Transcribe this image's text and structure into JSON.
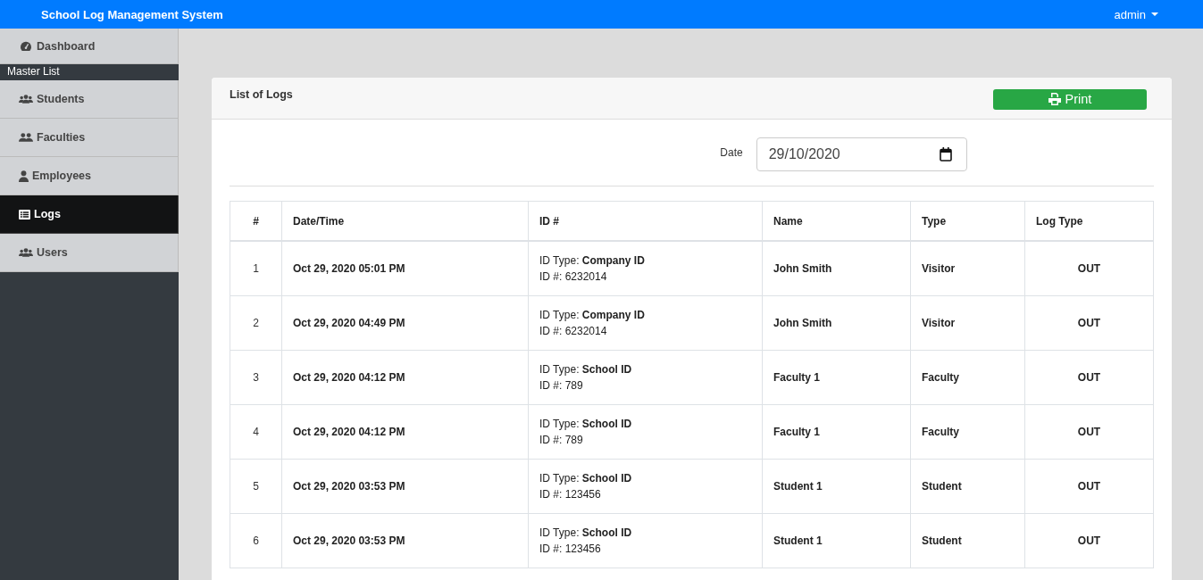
{
  "navbar": {
    "title": "School Log Management System",
    "user": "admin"
  },
  "sidebar": {
    "top_items": [
      {
        "label": "Dashboard",
        "kind": "gauge",
        "selected": false
      }
    ],
    "section_title": "Master List",
    "items": [
      {
        "label": "Students",
        "kind": "users",
        "selected": false
      },
      {
        "label": "Faculties",
        "kind": "pair",
        "selected": false
      },
      {
        "label": "Employees",
        "kind": "user",
        "selected": false
      },
      {
        "label": "Logs",
        "kind": "list",
        "selected": true
      },
      {
        "label": "Users",
        "kind": "users",
        "selected": false
      }
    ]
  },
  "card": {
    "title": "List of Logs",
    "print_button": "Print",
    "date_label": "Date",
    "date_value": "29/10/2020",
    "table": {
      "columns": [
        "#",
        "Date/Time",
        "ID #",
        "Name",
        "Type",
        "Log Type"
      ],
      "rows": [
        {
          "number": "1",
          "datetime": "Oct 29, 2020 05:01 PM",
          "id_type": "ID Type: **Company ID**",
          "id_number": "ID #: 6232014",
          "name": "John Smith",
          "type": "Visitor",
          "log_type": "OUT"
        },
        {
          "number": "2",
          "datetime": "Oct 29, 2020 04:49 PM",
          "id_type": "ID Type: **Company ID**",
          "id_number": "ID #: 6232014",
          "name": "John Smith",
          "type": "Visitor",
          "log_type": "OUT"
        },
        {
          "number": "3",
          "datetime": "Oct 29, 2020 04:12 PM",
          "id_type": "ID Type: **School ID**",
          "id_number": "ID #: 789",
          "name": "Faculty 1",
          "type": "Faculty",
          "log_type": "OUT"
        },
        {
          "number": "4",
          "datetime": "Oct 29, 2020 04:12 PM",
          "id_type": "ID Type: **School ID**",
          "id_number": "ID #: 789",
          "name": "Faculty 1",
          "type": "Faculty",
          "log_type": "OUT"
        },
        {
          "number": "5",
          "datetime": "Oct 29, 2020 03:53 PM",
          "id_type": "ID Type: **School ID**",
          "id_number": "ID #: 123456",
          "name": "Student 1",
          "type": "Student",
          "log_type": "OUT"
        },
        {
          "number": "6",
          "datetime": "Oct 29, 2020 03:53 PM",
          "id_type": "ID Type: **School ID**",
          "id_number": "ID #: 123456",
          "name": "Student 1",
          "type": "Student",
          "log_type": "OUT"
        }
      ]
    }
  }
}
